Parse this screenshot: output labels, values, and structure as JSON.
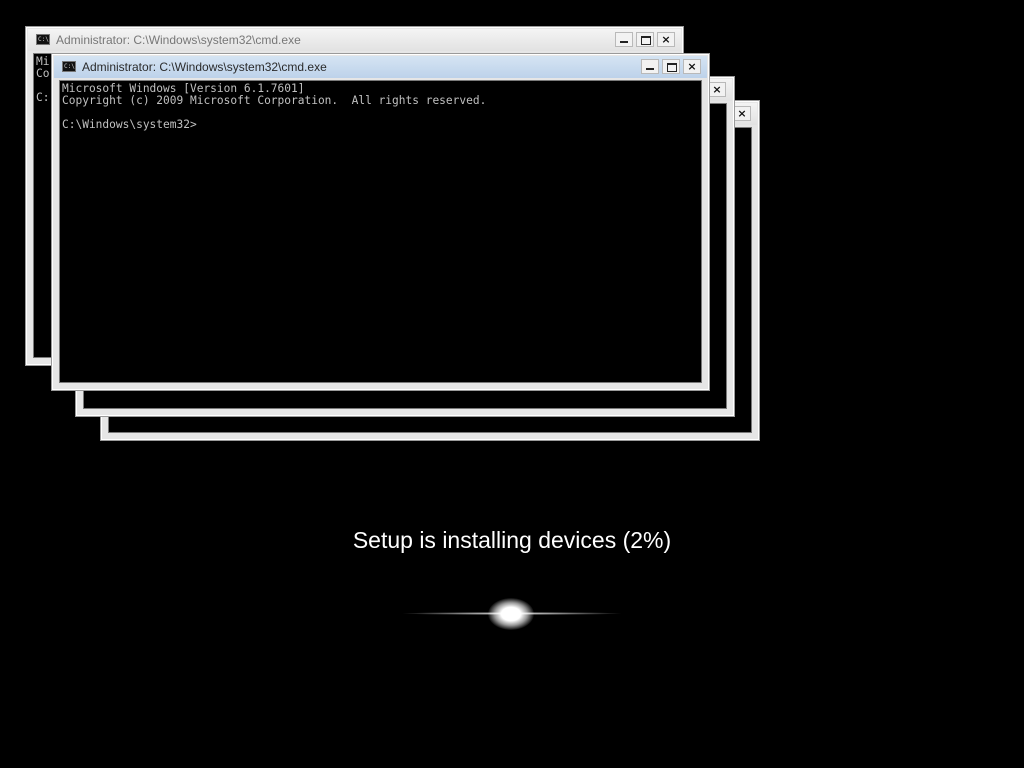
{
  "windows": [
    {
      "title": "Administrator: C:\\Windows\\system32\\cmd.exe",
      "icon": "cmd-icon",
      "icon_text": "C:\\.",
      "controls": [
        "minimize",
        "maximize",
        "close"
      ],
      "close_glyph": "×",
      "console_lines": [
        "Mi",
        "Co",
        "",
        "C:"
      ]
    },
    {
      "title": "",
      "icon": "cmd-icon",
      "icon_text": "",
      "controls": [
        "close"
      ],
      "close_glyph": "×",
      "console_lines": []
    },
    {
      "title": "",
      "icon": "cmd-icon",
      "icon_text": "",
      "controls": [
        "close"
      ],
      "close_glyph": "×",
      "console_lines": []
    },
    {
      "title": "Administrator: C:\\Windows\\system32\\cmd.exe",
      "icon": "cmd-icon",
      "icon_text": "C:\\.",
      "controls": [
        "minimize",
        "maximize",
        "close"
      ],
      "close_glyph": "×",
      "console_lines": [
        "Microsoft Windows [Version 6.1.7601]",
        "Copyright (c) 2009 Microsoft Corporation.  All rights reserved.",
        "",
        "C:\\Windows\\system32>"
      ]
    }
  ],
  "setup": {
    "status_text": "Setup is installing devices (2%)",
    "progress_percent": 2
  },
  "colors": {
    "background": "#000000",
    "console_text": "#c0c0c0",
    "status_text": "#ffffff"
  }
}
